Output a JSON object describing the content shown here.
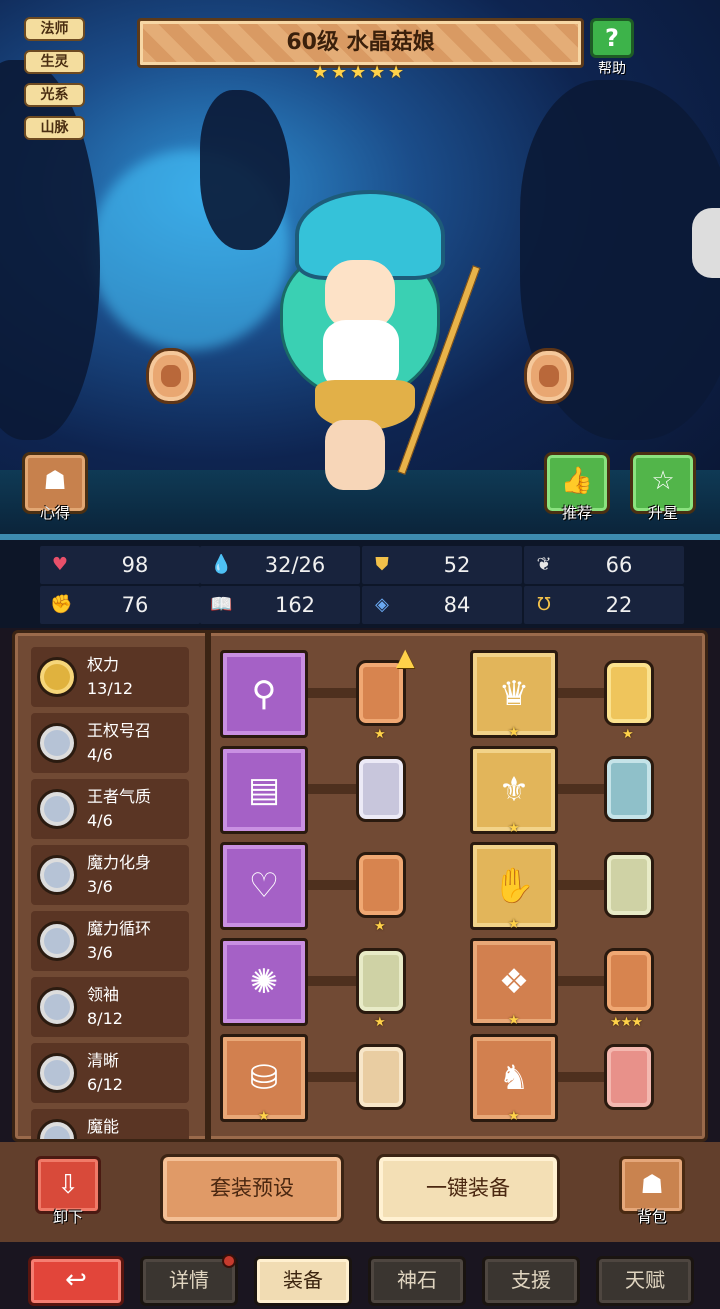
{
  "hero": {
    "title": "60级  水晶菇娘",
    "stars": [
      "★",
      "★",
      "★",
      "★",
      "★"
    ],
    "tags": [
      "法师",
      "生灵",
      "光系",
      "山脉"
    ]
  },
  "help": {
    "label": "帮助",
    "icon": "?"
  },
  "scene_buttons": {
    "insight": "心得",
    "recommend": "推荐",
    "star_up": "升星"
  },
  "stats": [
    {
      "icon": "heart-icon",
      "glyph": "♥",
      "color": "#e8506a",
      "value": "98"
    },
    {
      "icon": "mana-drop-icon",
      "glyph": "💧",
      "color": "#5ab8f0",
      "value": "32/26"
    },
    {
      "icon": "shield-icon",
      "glyph": "⛊",
      "color": "#f2c14a",
      "value": "52"
    },
    {
      "icon": "wing-icon",
      "glyph": "❦",
      "color": "#e6e6e6",
      "value": "66"
    },
    {
      "icon": "fist-icon",
      "glyph": "✊",
      "color": "#f0a98a",
      "value": "76"
    },
    {
      "icon": "spellbook-icon",
      "glyph": "📖",
      "color": "#e84a4a",
      "value": "162"
    },
    {
      "icon": "mana-shield-icon",
      "glyph": "◈",
      "color": "#6aa8f0",
      "value": "84"
    },
    {
      "icon": "magnet-icon",
      "glyph": "Ʊ",
      "color": "#f2c14a",
      "value": "22"
    }
  ],
  "perks": [
    {
      "name": "权力",
      "count": "13/12"
    },
    {
      "name": "王权号召",
      "count": "4/6"
    },
    {
      "name": "王者气质",
      "count": "4/6"
    },
    {
      "name": "魔力化身",
      "count": "3/6"
    },
    {
      "name": "魔力循环",
      "count": "3/6"
    },
    {
      "name": "领袖",
      "count": "8/12"
    },
    {
      "name": "清晰",
      "count": "6/12"
    },
    {
      "name": "魔能",
      "count": ""
    }
  ],
  "equipment": {
    "left": [
      {
        "item": "scepter-icon",
        "glyph": "⚲",
        "gem_stars": "★"
      },
      {
        "item": "tome-icon",
        "glyph": "▤",
        "gem_stars": ""
      },
      {
        "item": "necklace-icon",
        "glyph": "♡",
        "gem_stars": "★"
      },
      {
        "item": "amulet-icon",
        "glyph": "✺",
        "gem_stars": "★"
      },
      {
        "item": "boots-icon",
        "glyph": "⛁",
        "gem_stars": ""
      }
    ],
    "right": [
      {
        "item": "crown-icon",
        "glyph": "♛",
        "slot_stars": "★",
        "gem_stars": "★"
      },
      {
        "item": "robe-icon",
        "glyph": "⚜",
        "slot_stars": "★",
        "gem_stars": ""
      },
      {
        "item": "gauntlet-icon",
        "glyph": "✋",
        "slot_stars": "★",
        "gem_stars": ""
      },
      {
        "item": "belt-icon",
        "glyph": "❖",
        "slot_stars": "★",
        "gem_stars": "★★★"
      },
      {
        "item": "shoes-icon",
        "glyph": "♞",
        "slot_stars": "★",
        "gem_stars": ""
      }
    ],
    "left_bottom_slot_stars": "★",
    "upgrade_glyph": "▲"
  },
  "actions": {
    "unload": "卸下",
    "preset": "套装预设",
    "equip_all": "一键装备",
    "bag": "背包"
  },
  "tabs": [
    "详情",
    "装备",
    "神石",
    "支援",
    "天赋"
  ],
  "active_tab": "装备",
  "back_glyph": "↩"
}
